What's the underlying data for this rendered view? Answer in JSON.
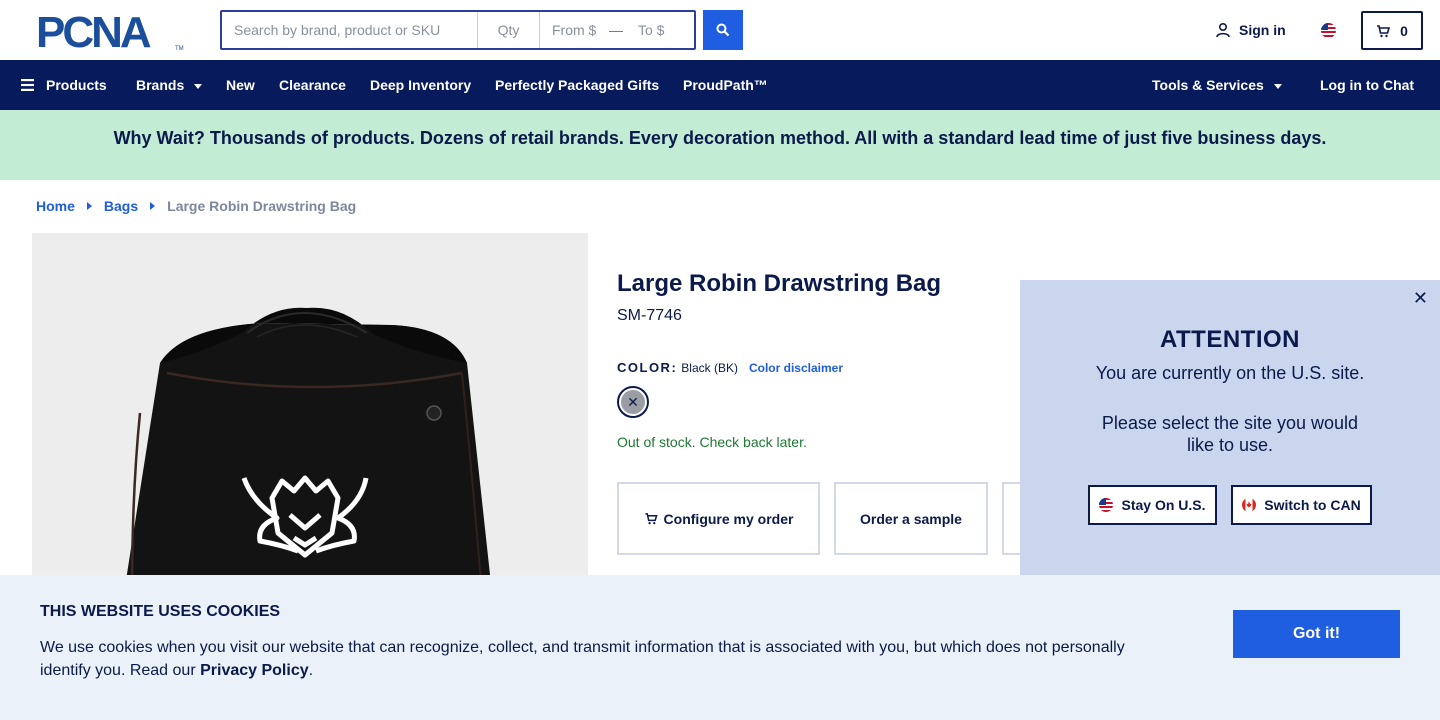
{
  "header": {
    "logo_text": "PCNA",
    "search": {
      "placeholder": "Search by brand, product or SKU",
      "qty_placeholder": "Qty",
      "from_placeholder": "From $",
      "range_dash": "—",
      "to_placeholder": "To $"
    },
    "signin_label": "Sign in",
    "cart_count": "0",
    "icons": {
      "search": "search-icon",
      "user": "user-icon",
      "cart": "cart-icon",
      "flag": "us-flag-icon"
    }
  },
  "nav": {
    "products": "Products",
    "brands": "Brands",
    "new": "New",
    "clearance": "Clearance",
    "deep_inventory": "Deep Inventory",
    "gifts": "Perfectly Packaged Gifts",
    "proudpath": "ProudPath™",
    "tools": "Tools & Services",
    "chat": "Log in to Chat"
  },
  "promo": "Why Wait? Thousands of products. Dozens of retail brands. Every decoration method. All with a standard lead time of just five business days.",
  "breadcrumb": {
    "home": "Home",
    "bags": "Bags",
    "current": "Large Robin Drawstring Bag"
  },
  "product": {
    "title": "Large Robin Drawstring Bag",
    "sku": "SM-7746",
    "color_label": "COLOR:",
    "color_value": "Black (BK)",
    "color_disclaimer": "Color disclaimer",
    "swatch_mark": "✕",
    "stock_status": "Out of stock. Check back later.",
    "actions": {
      "configure": "Configure my order",
      "sample": "Order a sample"
    }
  },
  "modal": {
    "close": "✕",
    "title": "ATTENTION",
    "message1": "You are currently on the U.S. site.",
    "message2": "Please select the site you would like to use.",
    "stay_label": "Stay On U.S.",
    "switch_label": "Switch to CAN"
  },
  "cookie": {
    "title": "THIS WEBSITE USES COOKIES",
    "text": "We use cookies when you visit our website that can recognize, collect, and transmit information that is associated with you, but which does not personally identify you. Read our ",
    "link": "Privacy Policy",
    "text_end": ".",
    "button": "Got it!"
  },
  "colors": {
    "navy": "#071a5c",
    "brand_blue": "#1f5ee0",
    "promo_bg": "#c3ecd5",
    "modal_bg": "#c9d6ee",
    "cookie_bg": "#ebf1f9",
    "stock_green": "#1d7a32"
  }
}
